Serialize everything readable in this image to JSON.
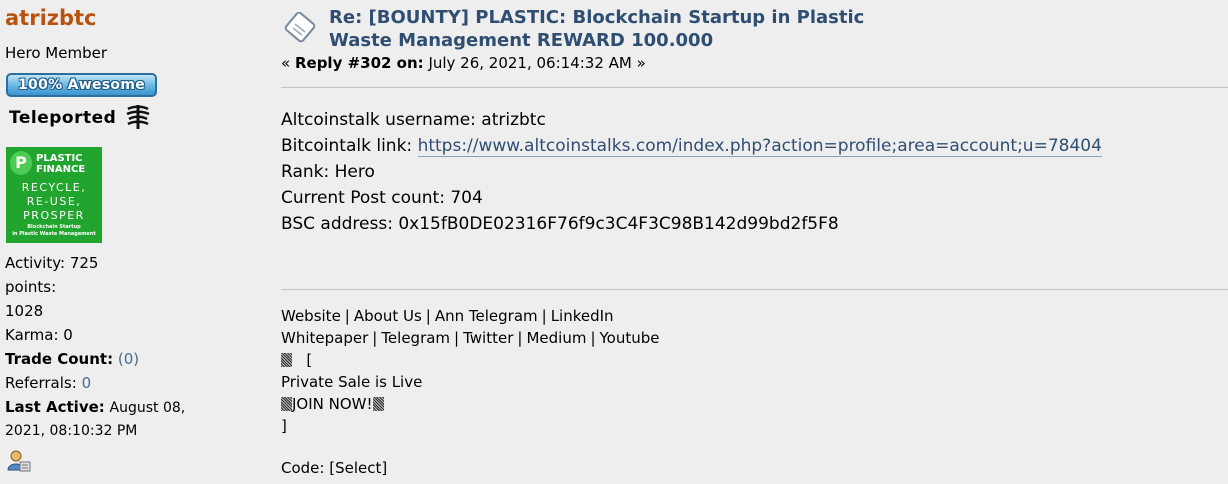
{
  "poster": {
    "username": "atrizbtc",
    "rank": "Hero Member",
    "badge_awesome": "100% Awesome",
    "badge_teleported": "Teleported",
    "avatar": {
      "top_text": "PLASTIC\nFINANCE",
      "mid_text": "RECYCLE,\nRE-USE,\nPROSPER",
      "bottom_text": "Blockchain Startup\nin Plastic Waste Management"
    },
    "activity": "Activity: 725",
    "points_label": "points:",
    "points_value": "1028",
    "karma": "Karma: 0",
    "trade_label": "Trade Count:",
    "trade_value": "(0)",
    "referrals_label": "Referrals:",
    "referrals_value": "0",
    "last_active_label": "Last Active:",
    "last_active_value_1": "August 08,",
    "last_active_value_2": "2021, 08:10:32 PM"
  },
  "post": {
    "subject_line_1": "Re: [BOUNTY] PLASTIC: Blockchain Startup in Plastic",
    "subject_line_2": "Waste Management REWARD 100.000",
    "reply_open": "«",
    "reply_label": "Reply #302 on:",
    "reply_date": "July 26, 2021, 06:14:32 AM",
    "reply_close": "»",
    "lines": [
      "Altcoinstalk username: atrizbtc",
      "Bitcointalk link:",
      "Rank: Hero",
      "Current Post count: 704",
      "BSC address: 0x15fB0DE02316F76f9c3C4F3C98B142d99bd2f5F8"
    ],
    "profile_link": "https://www.altcoinstalks.com/index.php?action=profile;area=account;u=78404"
  },
  "signature": {
    "row1": [
      "Website",
      "About Us",
      "Ann Telegram",
      "LinkedIn"
    ],
    "row2": [
      "Whitepaper",
      "Telegram",
      "Twitter",
      "Medium",
      "Youtube"
    ],
    "bracket_open": "[",
    "sale_text": "Private Sale is Live",
    "join_text": "JOIN NOW!",
    "bracket_close": "]",
    "separator": "|"
  },
  "code": {
    "label": "Code:",
    "select": "[Select]"
  }
}
